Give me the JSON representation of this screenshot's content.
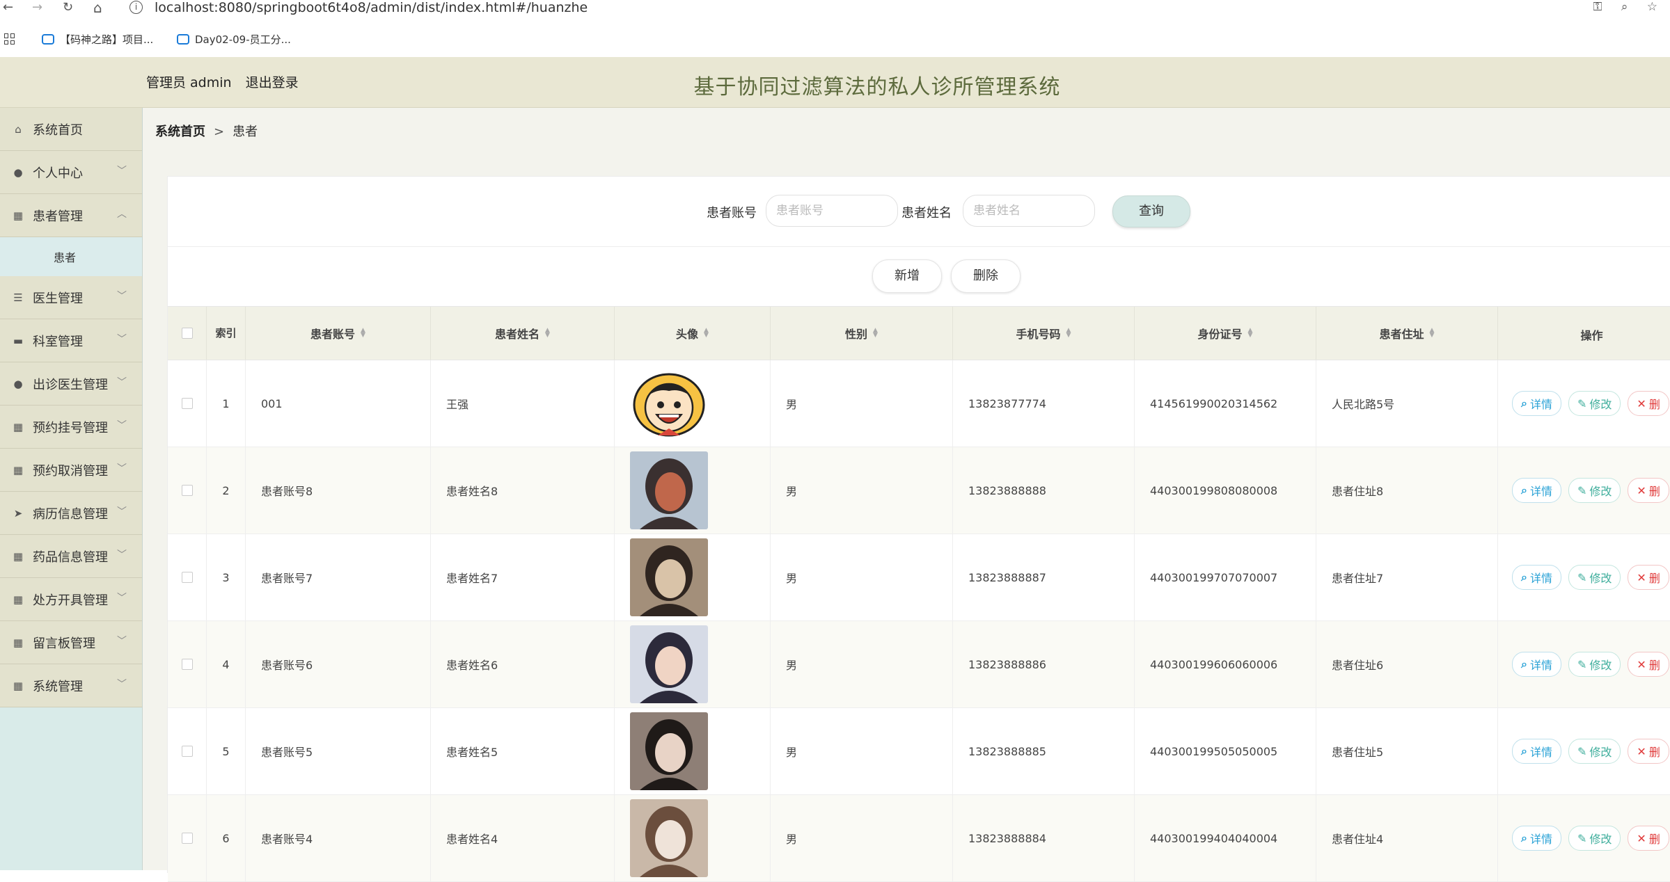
{
  "browser": {
    "back": "←",
    "forward": "→",
    "reload": "↻",
    "home": "⌂",
    "url": "localhost:8080/springboot6t4o8/admin/dist/index.html#/huanzhe",
    "bookmarks": [
      "【码神之路】项目...",
      "Day02-09-员工分..."
    ]
  },
  "header": {
    "role": "管理员 admin",
    "logout": "退出登录",
    "title": "基于协同过滤算法的私人诊所管理系统"
  },
  "sidebar": {
    "items": [
      {
        "label": "系统首页",
        "icon": "home-icon"
      },
      {
        "label": "个人中心",
        "icon": "user-icon"
      },
      {
        "label": "患者管理",
        "icon": "grid-icon"
      },
      {
        "label": "医生管理",
        "icon": "sliders-icon"
      },
      {
        "label": "科室管理",
        "icon": "monitor-icon"
      },
      {
        "label": "出诊医生管理",
        "icon": "pin-icon"
      },
      {
        "label": "预约挂号管理",
        "icon": "grid-icon"
      },
      {
        "label": "预约取消管理",
        "icon": "grid-icon"
      },
      {
        "label": "病历信息管理",
        "icon": "send-icon"
      },
      {
        "label": "药品信息管理",
        "icon": "grid-icon"
      },
      {
        "label": "处方开具管理",
        "icon": "grid-icon"
      },
      {
        "label": "留言板管理",
        "icon": "apps-icon"
      },
      {
        "label": "系统管理",
        "icon": "grid-icon"
      }
    ],
    "sub_item": "患者"
  },
  "breadcrumb": {
    "home": "系统首页",
    "sep": ">",
    "current": "患者"
  },
  "search": {
    "account_label": "患者账号",
    "account_placeholder": "患者账号",
    "name_label": "患者姓名",
    "name_placeholder": "患者姓名",
    "query_button": "查询"
  },
  "actions": {
    "add": "新增",
    "delete": "删除"
  },
  "table": {
    "headers": {
      "index": "索引",
      "account": "患者账号",
      "name": "患者姓名",
      "avatar": "头像",
      "gender": "性别",
      "phone": "手机号码",
      "idcard": "身份证号",
      "address": "患者住址",
      "ops": "操作"
    },
    "rows": [
      {
        "index": "1",
        "account": "001",
        "name": "王强",
        "gender": "男",
        "phone": "13823877774",
        "idcard": "414561990020314562",
        "address": "人民北路5号",
        "avatar": "cartoon"
      },
      {
        "index": "2",
        "account": "患者账号8",
        "name": "患者姓名8",
        "gender": "男",
        "phone": "13823888888",
        "idcard": "440300199808080008",
        "address": "患者住址8",
        "avatar": "photo"
      },
      {
        "index": "3",
        "account": "患者账号7",
        "name": "患者姓名7",
        "gender": "男",
        "phone": "13823888887",
        "idcard": "440300199707070007",
        "address": "患者住址7",
        "avatar": "photo"
      },
      {
        "index": "4",
        "account": "患者账号6",
        "name": "患者姓名6",
        "gender": "男",
        "phone": "13823888886",
        "idcard": "440300199606060006",
        "address": "患者住址6",
        "avatar": "photo"
      },
      {
        "index": "5",
        "account": "患者账号5",
        "name": "患者姓名5",
        "gender": "男",
        "phone": "13823888885",
        "idcard": "440300199505050005",
        "address": "患者住址5",
        "avatar": "photo"
      },
      {
        "index": "6",
        "account": "患者账号4",
        "name": "患者姓名4",
        "gender": "男",
        "phone": "13823888884",
        "idcard": "440300199404040004",
        "address": "患者住址4",
        "avatar": "photo"
      }
    ],
    "op_labels": {
      "detail": "详情",
      "edit": "修改",
      "delete": "删"
    }
  }
}
